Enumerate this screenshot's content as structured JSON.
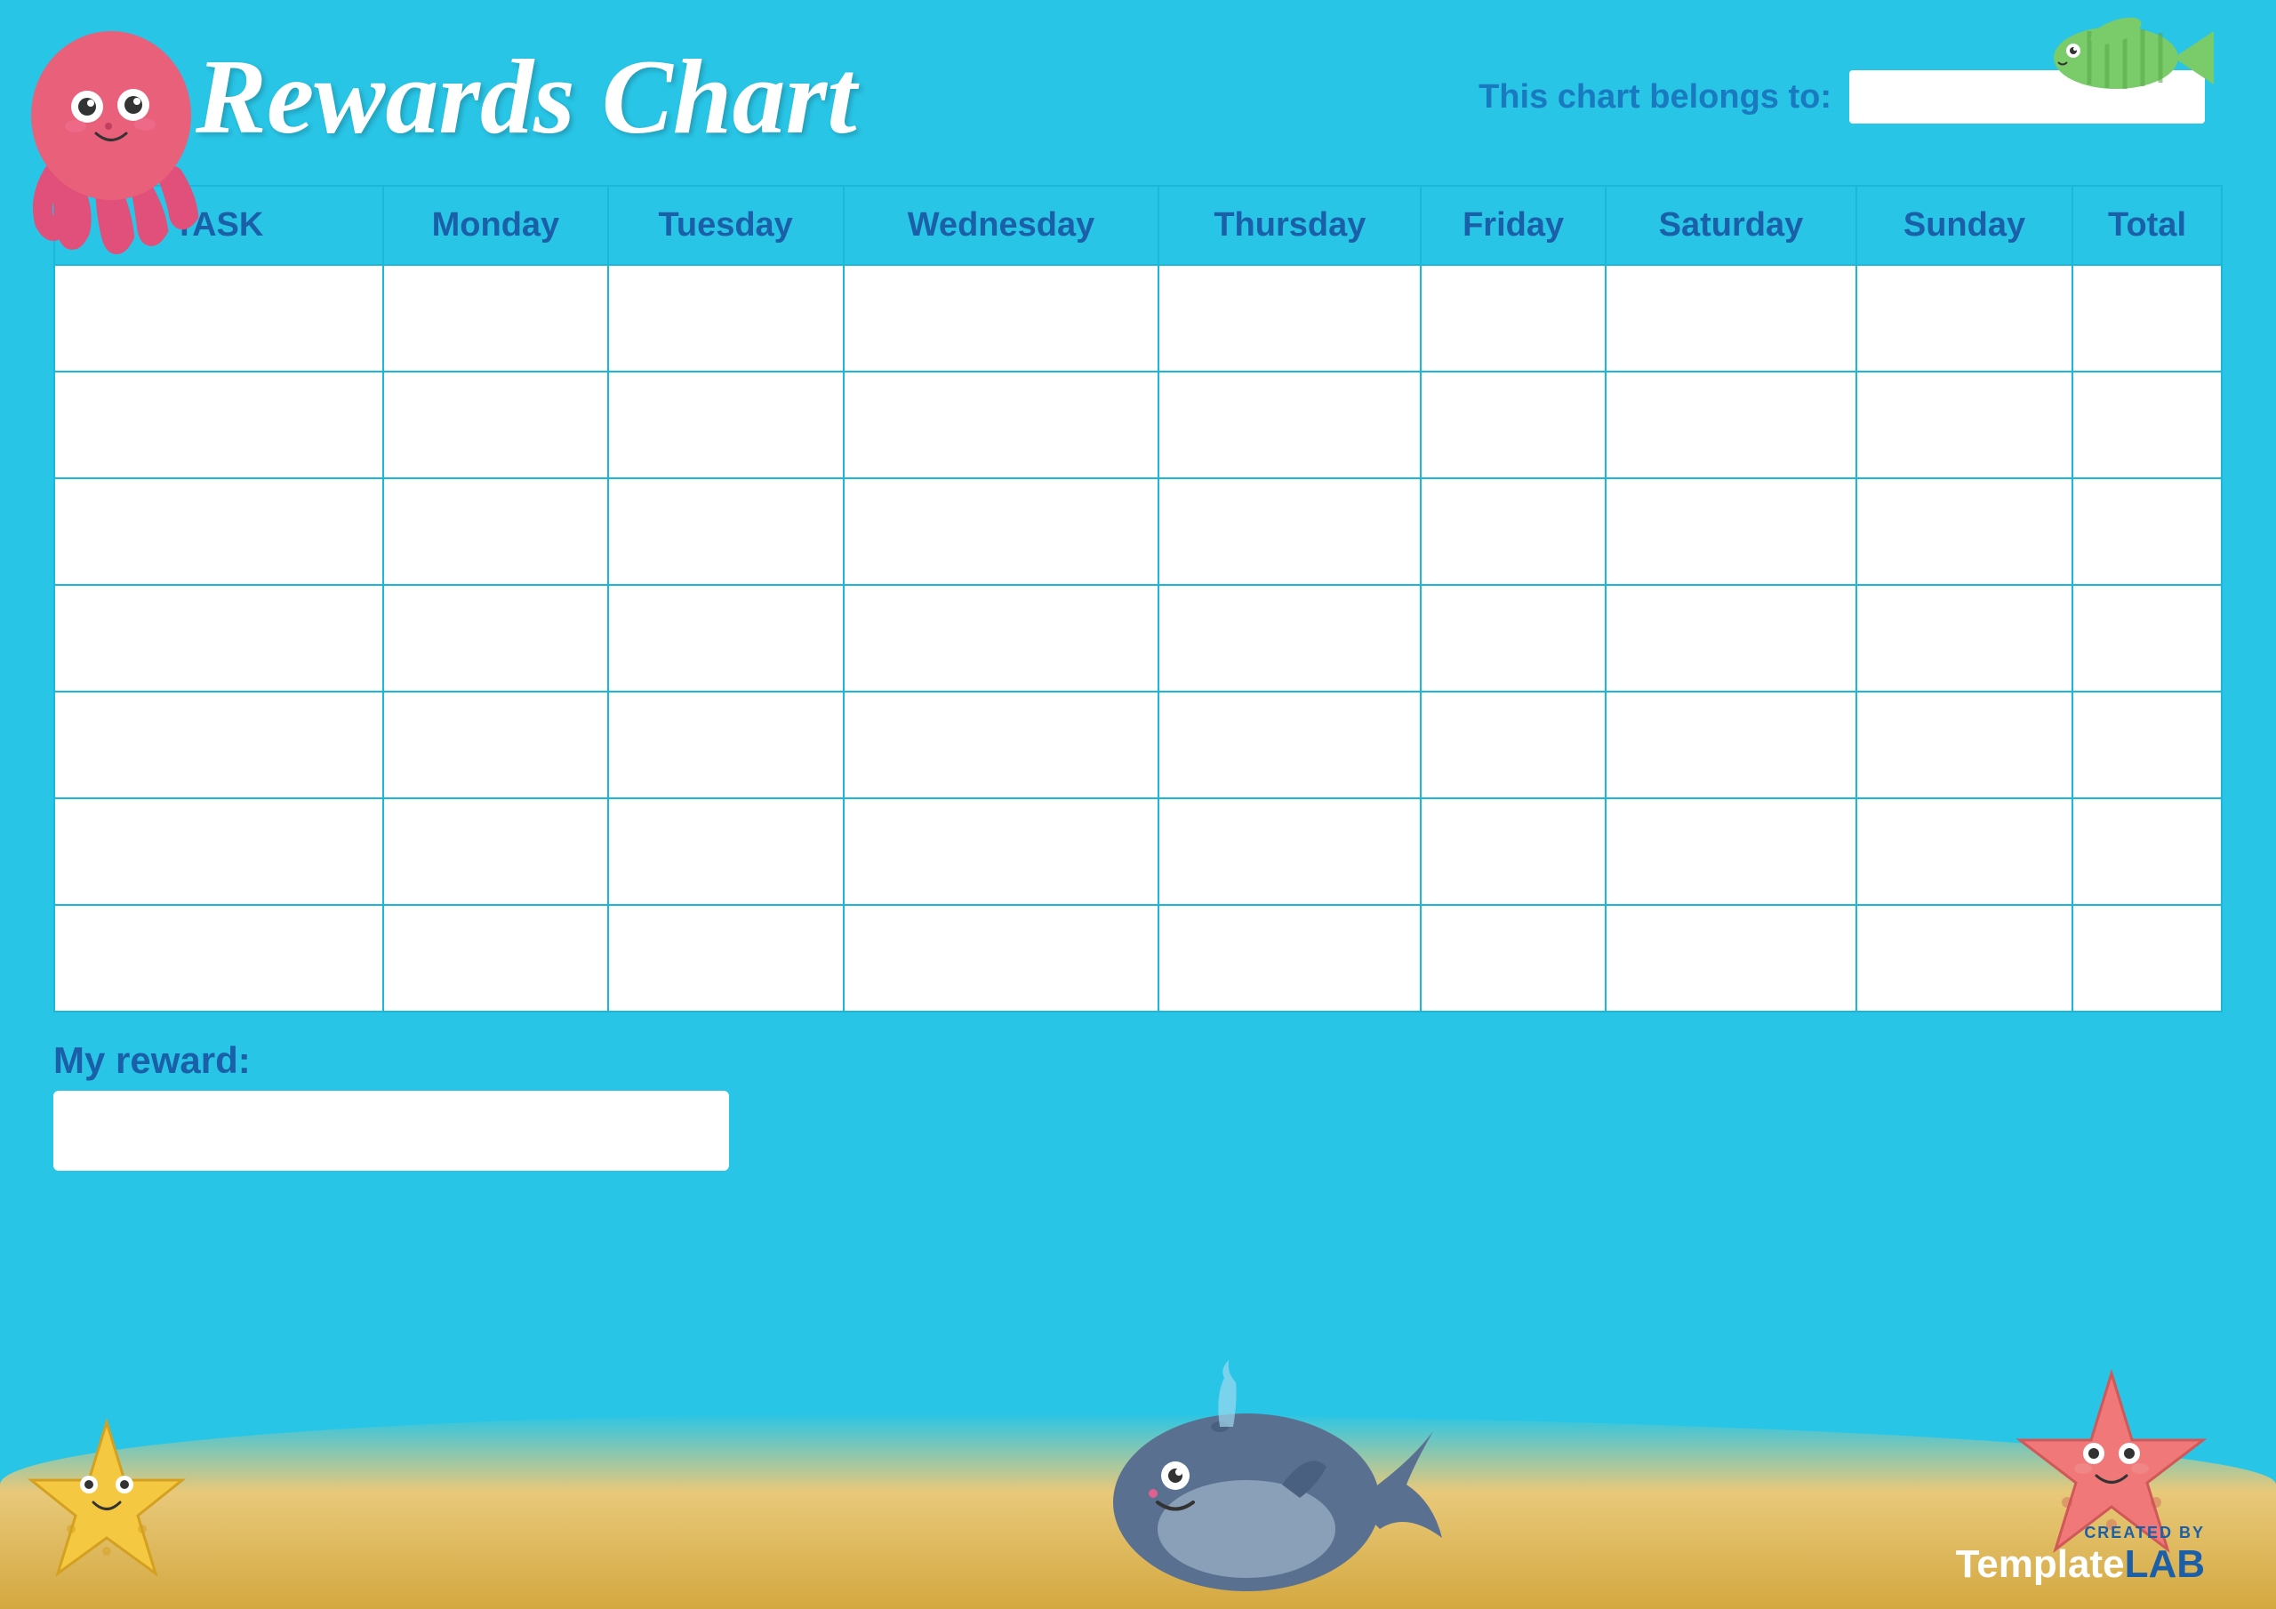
{
  "header": {
    "title": "Rewards Chart",
    "belongs_label": "This chart belongs to:",
    "belongs_placeholder": ""
  },
  "table": {
    "columns": [
      "TASK",
      "Monday",
      "Tuesday",
      "Wednesday",
      "Thursday",
      "Friday",
      "Saturday",
      "Sunday",
      "Total"
    ],
    "row_count": 7
  },
  "footer": {
    "reward_label": "My reward:",
    "reward_placeholder": "",
    "template_lab_created": "CREATED BY",
    "template_lab_brand": "TemplateLAB"
  },
  "colors": {
    "background": "#29c5e6",
    "header_text": "#1a5fa8",
    "title_white": "#ffffff",
    "table_border": "#1ab8d8",
    "sand": "#e8c97a",
    "sand_dark": "#d4b05a"
  }
}
